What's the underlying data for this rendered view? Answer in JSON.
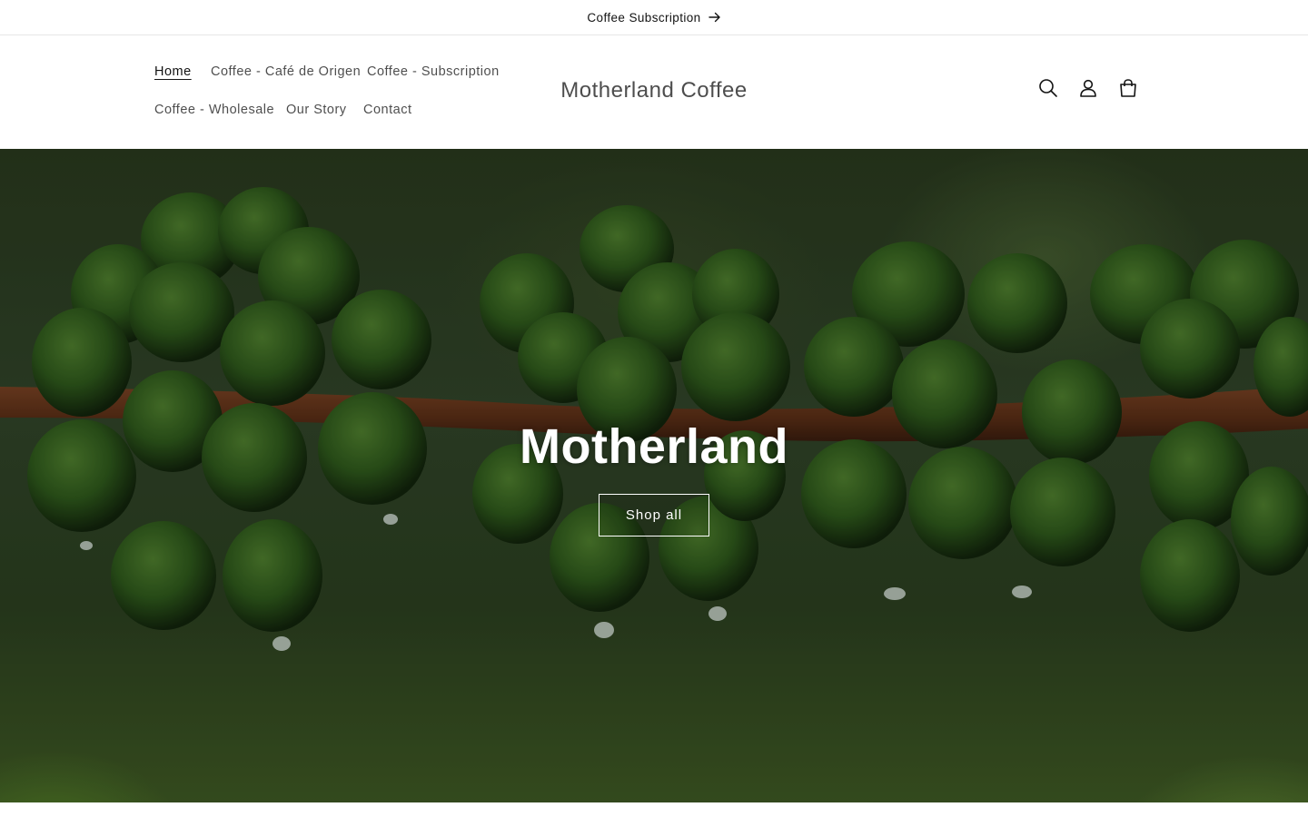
{
  "announcement": {
    "text": "Coffee Subscription",
    "icon": "arrow-right-icon"
  },
  "header": {
    "logo": "Motherland Coffee",
    "nav": [
      {
        "label": "Home",
        "active": true
      },
      {
        "label": "Coffee - Café de Origen",
        "active": false
      },
      {
        "label": "Coffee - Subscription",
        "active": false
      },
      {
        "label": "Coffee - Wholesale",
        "active": false
      },
      {
        "label": "Our Story",
        "active": false
      },
      {
        "label": "Contact",
        "active": false
      }
    ],
    "icons": [
      "search-icon",
      "account-icon",
      "cart-icon"
    ]
  },
  "hero": {
    "title": "Motherland",
    "button_label": "Shop all"
  },
  "colors": {
    "text": "#121212",
    "border": "#e6e6e6",
    "hero_text": "#ffffff",
    "coffee_cherry": "#2f5a1c",
    "branch": "#6b3a1f"
  }
}
